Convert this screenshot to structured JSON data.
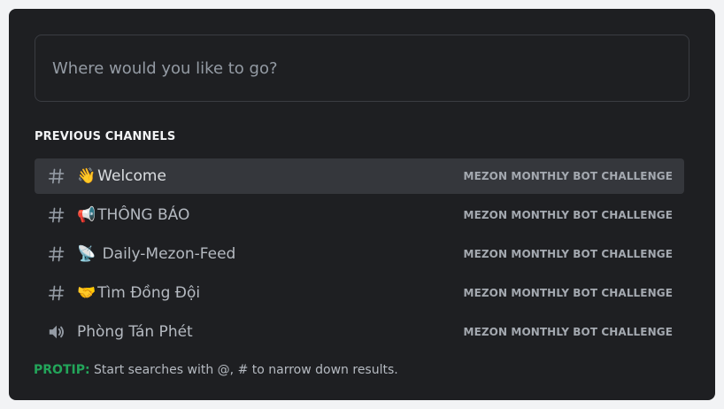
{
  "search": {
    "placeholder": "Where would you like to go?",
    "value": ""
  },
  "section": {
    "title": "PREVIOUS CHANNELS"
  },
  "channels": [
    {
      "kind": "text-channel",
      "icon": "hash-icon",
      "emoji": "👋",
      "name": "Welcome",
      "server": "MEZON MONTHLY BOT CHALLENGE",
      "selected": true
    },
    {
      "kind": "text-channel",
      "icon": "hash-icon",
      "emoji": "📢",
      "name": "THÔNG BÁO",
      "server": "MEZON MONTHLY BOT CHALLENGE",
      "selected": false
    },
    {
      "kind": "text-channel",
      "icon": "hash-icon",
      "emoji": "📡",
      "name": " Daily-Mezon-Feed",
      "server": "MEZON MONTHLY BOT CHALLENGE",
      "selected": false
    },
    {
      "kind": "text-channel",
      "icon": "hash-icon",
      "emoji": "🤝",
      "name": "Tìm Đồng Đội",
      "server": "MEZON MONTHLY BOT CHALLENGE",
      "selected": false
    },
    {
      "kind": "voice-channel",
      "icon": "speaker-icon",
      "emoji": "",
      "name": "Phòng Tán Phét",
      "server": "MEZON MONTHLY BOT CHALLENGE",
      "selected": false
    }
  ],
  "protip": {
    "label": "PROTIP:",
    "text": " Start searches with @, # to narrow down results."
  },
  "colors": {
    "background": "#1e1f22",
    "selected_row": "#35373c",
    "protip_accent": "#23a55a",
    "muted_text": "#949ba4"
  }
}
